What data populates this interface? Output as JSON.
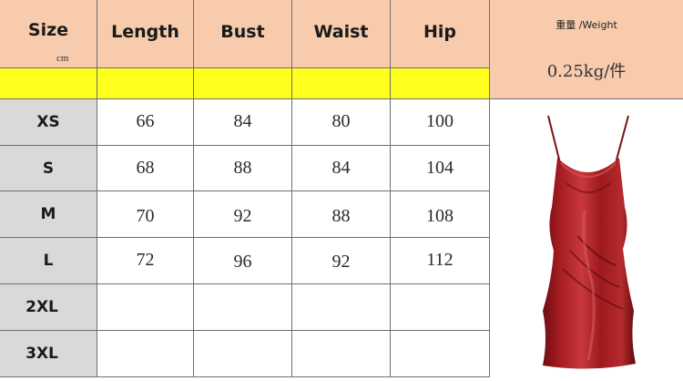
{
  "chart_data": {
    "type": "table",
    "columns": [
      "Size",
      "Length",
      "Bust",
      "Waist",
      "Hip"
    ],
    "unit": "cm",
    "rows": [
      {
        "size": "XS",
        "values": [
          "66",
          "84",
          "80",
          "100"
        ]
      },
      {
        "size": "S",
        "values": [
          "68",
          "88",
          "84",
          "104"
        ]
      },
      {
        "size": "M",
        "values": [
          "70",
          "92",
          "88",
          "108"
        ]
      },
      {
        "size": "L",
        "values": [
          "72",
          "96",
          "92",
          "112"
        ]
      },
      {
        "size": "2XL",
        "values": [
          "",
          "",
          "",
          ""
        ]
      },
      {
        "size": "3XL",
        "values": [
          "",
          "",
          "",
          ""
        ]
      }
    ],
    "weight_label": "重量 /Weight",
    "weight_value": "0.25kg/件"
  },
  "colors": {
    "header_bg": "#f8cbad",
    "highlight_row": "#ffff1e",
    "size_label_bg": "#d9d9d9",
    "border": "#6e6e6e",
    "dress": "#9e1a1e"
  },
  "image": {
    "icon": "red-satin-slip-dress-icon"
  }
}
